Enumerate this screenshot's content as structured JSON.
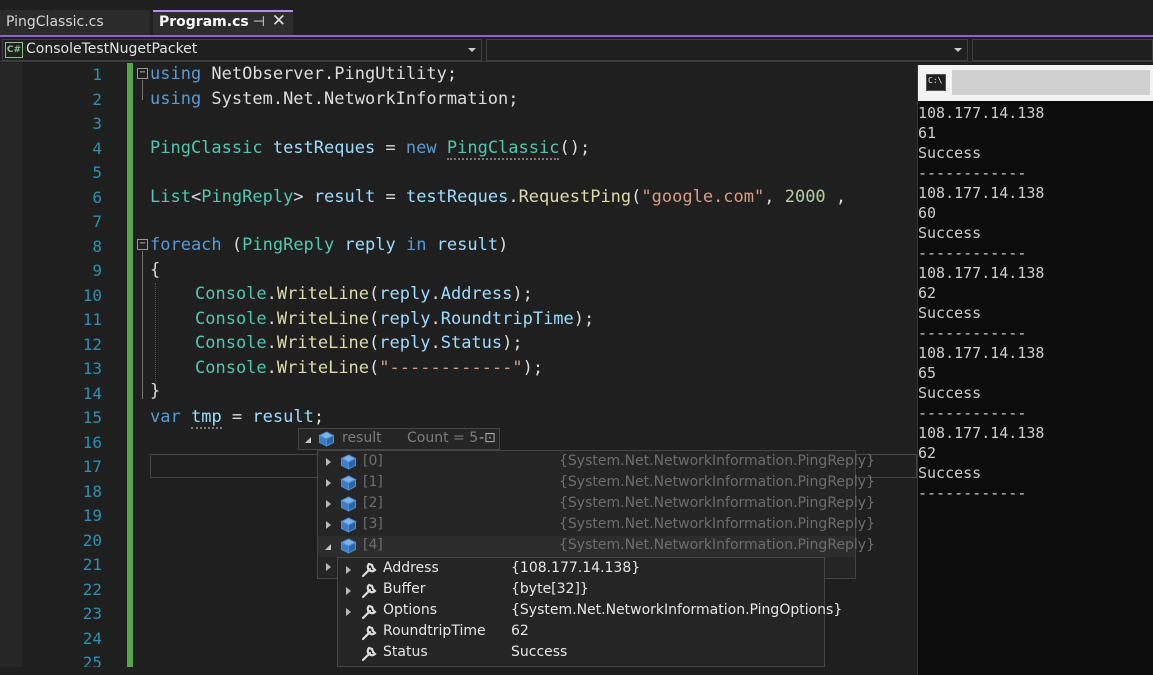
{
  "tabs": [
    {
      "label": "PingClassic.cs",
      "active": false
    },
    {
      "label": "Program.cs",
      "active": true
    }
  ],
  "tab_pin_glyph": "⊣",
  "tab_close_glyph": "✕",
  "navbar": {
    "project": "ConsoleTestNugetPacket",
    "project_icon_text": "C#"
  },
  "line_numbers": [
    "1",
    "2",
    "3",
    "4",
    "5",
    "6",
    "7",
    "8",
    "9",
    "10",
    "11",
    "12",
    "13",
    "14",
    "15",
    "16",
    "17",
    "18",
    "19",
    "20",
    "21",
    "22",
    "23",
    "24",
    "25"
  ],
  "code": {
    "l1": [
      "using",
      " NetObserver.PingUtility;"
    ],
    "l2": [
      "using",
      " System.Net.NetworkInformation;"
    ],
    "l4": [
      "PingClassic",
      " testReques",
      " = ",
      "new",
      " ",
      "PingClassic",
      "();"
    ],
    "l6": [
      "List",
      "<",
      "PingReply",
      "> ",
      "result",
      " = ",
      "testReques",
      ".",
      "RequestPing",
      "(",
      "\"google.com\"",
      ", ",
      "2000",
      " ,"
    ],
    "l8": [
      "foreach",
      " (",
      "PingReply",
      " ",
      "reply",
      " ",
      "in",
      " ",
      "result",
      ")"
    ],
    "l9": "{",
    "l10": [
      "Console",
      ".",
      "WriteLine",
      "(",
      "reply",
      ".",
      "Address",
      ");"
    ],
    "l11": [
      "Console",
      ".",
      "WriteLine",
      "(",
      "reply",
      ".",
      "RoundtripTime",
      ");"
    ],
    "l12": [
      "Console",
      ".",
      "WriteLine",
      "(",
      "reply",
      ".",
      "Status",
      ");"
    ],
    "l13": [
      "Console",
      ".",
      "WriteLine",
      "(",
      "\"------------\"",
      ");"
    ],
    "l14": "}",
    "l15": [
      "var",
      " ",
      "tmp",
      " = ",
      "result",
      ";"
    ]
  },
  "console_output": [
    "108.177.14.138",
    "61",
    "Success",
    "------------",
    "108.177.14.138",
    "60",
    "Success",
    "------------",
    "108.177.14.138",
    "62",
    "Success",
    "------------",
    "108.177.14.138",
    "65",
    "Success",
    "------------",
    "108.177.14.138",
    "62",
    "Success",
    "------------"
  ],
  "datatip": {
    "name": "result",
    "count": "Count = 5",
    "pin_glyph": "-⊡",
    "items": [
      {
        "index": "[0]",
        "value": "{System.Net.NetworkInformation.PingReply}"
      },
      {
        "index": "[1]",
        "value": "{System.Net.NetworkInformation.PingReply}"
      },
      {
        "index": "[2]",
        "value": "{System.Net.NetworkInformation.PingReply}"
      },
      {
        "index": "[3]",
        "value": "{System.Net.NetworkInformation.PingReply}"
      },
      {
        "index": "[4]",
        "value": "{System.Net.NetworkInformation.PingReply}"
      }
    ],
    "expanded": [
      {
        "name": "Address",
        "value": "{108.177.14.138}",
        "expandable": true
      },
      {
        "name": "Buffer",
        "value": "{byte[32]}",
        "expandable": true
      },
      {
        "name": "Options",
        "value": "{System.Net.NetworkInformation.PingOptions}",
        "expandable": true
      },
      {
        "name": "RoundtripTime",
        "value": "62",
        "expandable": false
      },
      {
        "name": "Status",
        "value": "Success",
        "expandable": false
      }
    ]
  },
  "colors": {
    "keyword": "#569cd6",
    "type": "#4ec9b0",
    "variable": "#9cdcfe",
    "method": "#dcdcaa",
    "string": "#d69d85",
    "number": "#b5cea8",
    "line_number": "#2b91af",
    "accent": "#8c60d8",
    "change_bar": "#57a64a"
  }
}
